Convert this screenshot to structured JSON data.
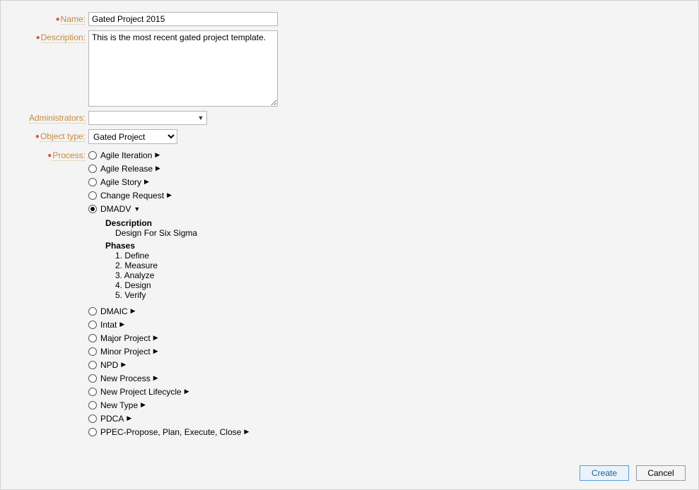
{
  "labels": {
    "name": "Name:",
    "description": "Description:",
    "administrators": "Administrators:",
    "object_type": "Object type:",
    "process": "Process:"
  },
  "fields": {
    "name_value": "Gated Project 2015",
    "description_value": "This is the most recent gated project template.",
    "administrators_value": "",
    "object_type_value": "Gated Project"
  },
  "process": {
    "items": [
      {
        "label": "Agile Iteration",
        "selected": false,
        "expanded": false
      },
      {
        "label": "Agile Release",
        "selected": false,
        "expanded": false
      },
      {
        "label": "Agile Story",
        "selected": false,
        "expanded": false
      },
      {
        "label": "Change Request",
        "selected": false,
        "expanded": false
      },
      {
        "label": "DMADV",
        "selected": true,
        "expanded": true,
        "desc_heading": "Description",
        "desc_text": "Design For Six Sigma",
        "phases_heading": "Phases",
        "phases": [
          "1. Define",
          "2. Measure",
          "3. Analyze",
          "4. Design",
          "5. Verify"
        ]
      },
      {
        "label": "DMAIC",
        "selected": false,
        "expanded": false
      },
      {
        "label": "Intat",
        "selected": false,
        "expanded": false
      },
      {
        "label": "Major Project",
        "selected": false,
        "expanded": false
      },
      {
        "label": "Minor Project",
        "selected": false,
        "expanded": false
      },
      {
        "label": "NPD",
        "selected": false,
        "expanded": false
      },
      {
        "label": "New Process",
        "selected": false,
        "expanded": false
      },
      {
        "label": "New Project Lifecycle",
        "selected": false,
        "expanded": false
      },
      {
        "label": "New Type",
        "selected": false,
        "expanded": false
      },
      {
        "label": "PDCA",
        "selected": false,
        "expanded": false
      },
      {
        "label": "PPEC-Propose, Plan, Execute, Close",
        "selected": false,
        "expanded": false
      }
    ]
  },
  "buttons": {
    "create": "Create",
    "cancel": "Cancel"
  }
}
